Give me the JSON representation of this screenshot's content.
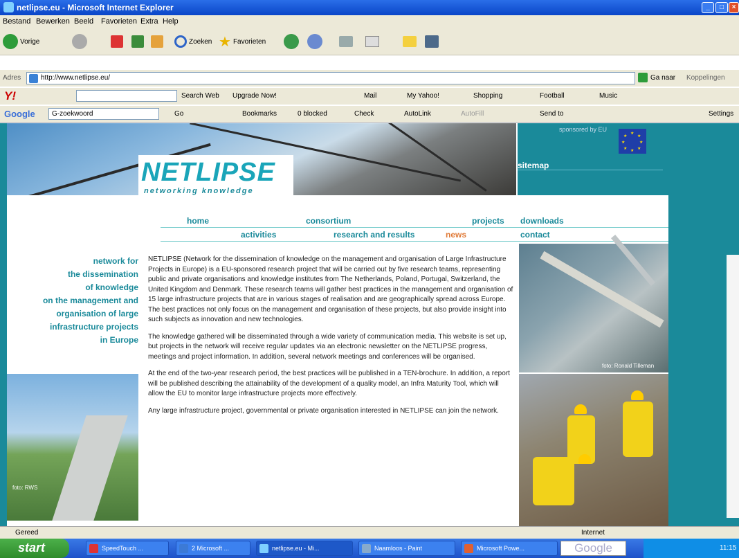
{
  "window": {
    "title": "netlipse.eu - Microsoft Internet Explorer"
  },
  "menu": [
    "Bestand",
    "Bewerken",
    "Beeld",
    "Favorieten",
    "Extra",
    "Help"
  ],
  "toolbar": {
    "back_label": "Vorige",
    "search_label": "Zoeken",
    "favorites_label": "Favorieten"
  },
  "address": {
    "label": "Adres",
    "url": "http://www.netlipse.eu/",
    "go_label": "Ga naar",
    "links_label": "Koppelingen"
  },
  "yahoo_bar": {
    "search_label": "Search Web",
    "upgrade_label": "Upgrade Now!",
    "mail_label": "Mail",
    "my_yahoo_label": "My Yahoo!",
    "shopping_label": "Shopping",
    "football_label": "Football",
    "more_label": "Music"
  },
  "google_bar": {
    "logo": "Google",
    "field": "G-zoekwoord",
    "go_label": "Go",
    "bookmarks_label": "Bookmarks",
    "blocked_label": "0 blocked",
    "check_label": "Check",
    "autolink_label": "AutoLink",
    "autofill_label": "AutoFill",
    "send_label": "Send to",
    "settings_label": "Settings"
  },
  "site": {
    "sponsor_text": "sponsored by EU",
    "logo_big": "NETLIPSE",
    "logo_sub": "networking knowledge",
    "sitemap": "sitemap",
    "nav": {
      "home": "home",
      "consortium": "consortium",
      "projects": "projects",
      "downloads": "downloads",
      "activities": "activities",
      "research": "research and results",
      "news": "news",
      "contact": "contact"
    },
    "tagline": [
      "network for",
      "the dissemination",
      "of knowledge",
      "on the management and",
      "organisation of large",
      "infrastructure projects",
      "in Europe"
    ],
    "paragraphs": [
      "NETLIPSE (Network for the dissemination of knowledge on the management and organisation of Large Infrastructure Projects in Europe) is a EU-sponsored research project that will be carried out by five research teams, representing public and private organisations and knowledge institutes from The Netherlands, Poland, Portugal, Switzerland, the United Kingdom and Denmark. These research teams will gather best practices in the management and organisation of 15 large infrastructure projects that are in various stages of realisation and are geographically spread across Europe. The best practices not only focus on the management and organisation of these projects, but also provide insight into such subjects as innovation and new technologies.",
      "The knowledge gathered will be disseminated through a wide variety of communication media. This website is set up, but projects in the network will receive regular updates via an electronic newsletter on the NETLIPSE progress, meetings and project information. In addition, several network meetings and conferences will be organised.",
      "At the end of the two-year research period, the best practices will be published in a TEN-brochure. In addition, a report will be published describing the attainability of the development of a quality model, an Infra Maturity Tool, which will allow the EU to monitor large infrastructure projects more effectively.",
      "Any large infrastructure project, governmental or private organisation interested in NETLIPSE can join the network."
    ],
    "photo_credit_bridge": "foto: Ronald Tilleman",
    "photo_credit_canal": "foto: RWS"
  },
  "statusbar": {
    "left": "Gereed",
    "right": "Internet"
  },
  "taskbar": {
    "start": "start",
    "tasks": [
      "SpeedTouch ...",
      "2 Microsoft ...",
      "netlipse.eu - Mi...",
      "Naamloos - Paint",
      "Microsoft Powe..."
    ],
    "google_label": "Google",
    "clock": "11:15"
  }
}
